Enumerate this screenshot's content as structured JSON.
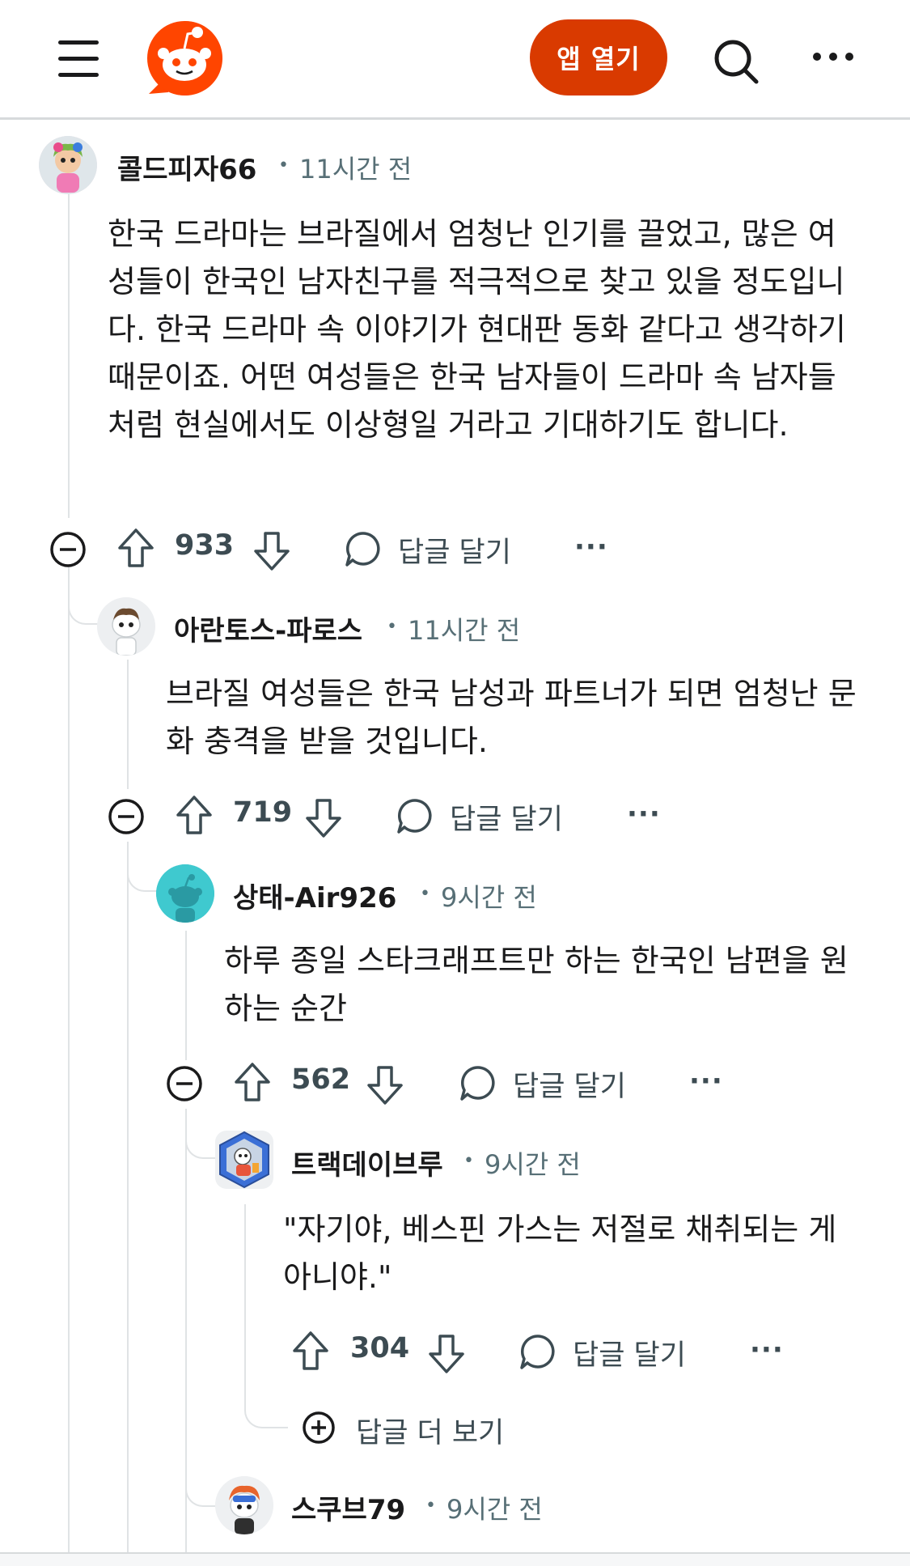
{
  "header": {
    "open_app_label": "앱 열기",
    "icons": [
      "menu-icon",
      "reddit-logo",
      "search-icon",
      "more-icon"
    ],
    "accent_color": "#d93a00"
  },
  "comments": [
    {
      "username": "콜드피자66",
      "time": "11시간 전",
      "body": "한국 드라마는 브라질에서 엄청난 인기를 끌었고, 많은 여성들이 한국인 남자친구를 적극적으로 찾고 있을 정도입니다. 한국 드라마 속 이야기가 현대판 동화 같다고 생각하기 때문이죠. 어떤 여성들은 한국 남자들이 드라마 속 남자들처럼 현실에서도 이상형일 거라고 기대하기도 합니다.",
      "votes": "933",
      "reply_label": "답글 달기",
      "more": "···"
    },
    {
      "username": "아란토스-파로스",
      "time": "11시간 전",
      "body": "브라질 여성들은 한국 남성과 파트너가 되면 엄청난 문화 충격을 받을 것입니다.",
      "votes": "719",
      "reply_label": "답글 달기",
      "more": "···"
    },
    {
      "username": "상태-Air926",
      "time": "9시간 전",
      "body": "하루 종일 스타크래프트만 하는 한국인 남편을 원하는 순간",
      "votes": "562",
      "reply_label": "답글 달기",
      "more": "···"
    },
    {
      "username": "트랙데이브루",
      "time": "9시간 전",
      "body": "\"자기야, 베스핀 가스는 저절로 채취되는 게 아니야.\"",
      "votes": "304",
      "reply_label": "답글 달기",
      "more": "···"
    },
    {
      "username": "스쿠브79",
      "time": "9시간 전"
    }
  ],
  "more_replies_label": "답글 더 보기",
  "separator_dot": "•"
}
